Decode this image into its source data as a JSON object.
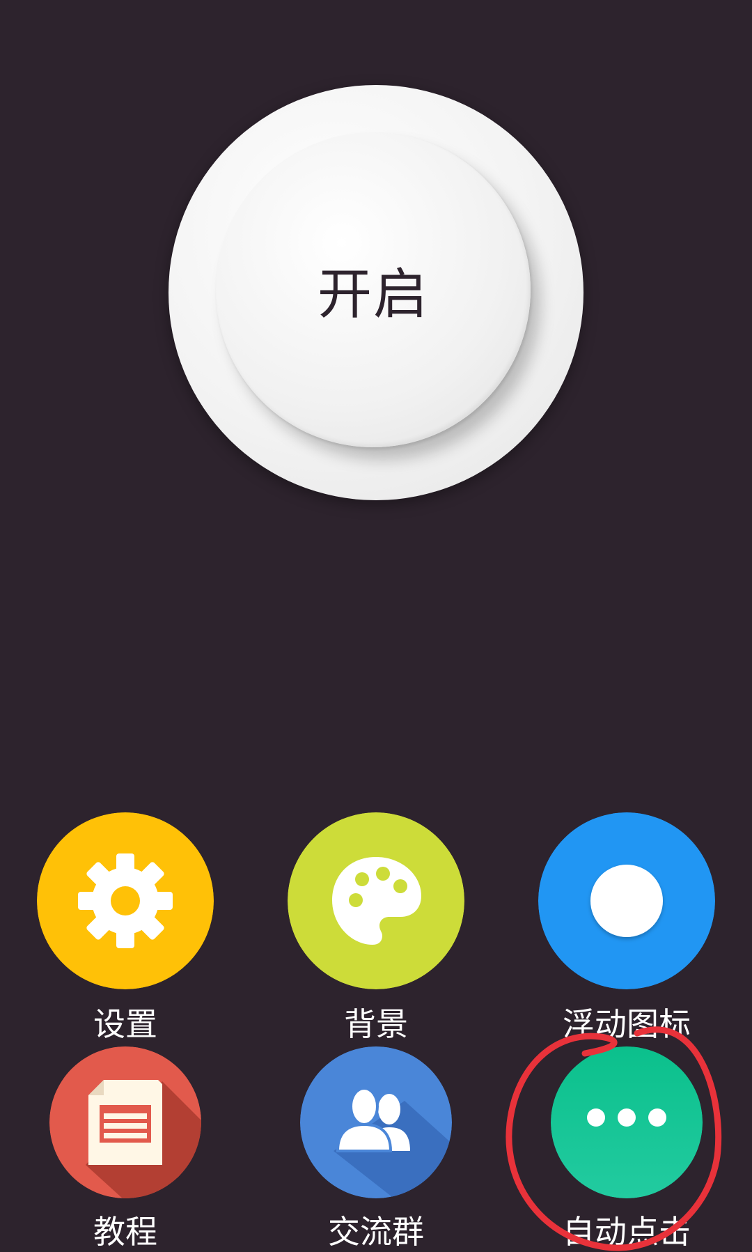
{
  "start_button": {
    "label": "开启"
  },
  "features": {
    "settings": {
      "label": "设置",
      "icon": "gear-icon",
      "color": "#FFC107"
    },
    "background": {
      "label": "背景",
      "icon": "palette-icon",
      "color": "#CDDC39"
    },
    "floating_icon": {
      "label": "浮动图标",
      "icon": "circle-icon",
      "color": "#2196F3"
    },
    "tutorial": {
      "label": "教程",
      "icon": "document-icon",
      "color": "#E25A4C"
    },
    "chat_group": {
      "label": "交流群",
      "icon": "group-icon",
      "color": "#4A86D8"
    },
    "auto_click": {
      "label": "自动点击",
      "icon": "more-dots-icon",
      "color": "#10C28F"
    }
  },
  "annotation_color": "#E8323A"
}
